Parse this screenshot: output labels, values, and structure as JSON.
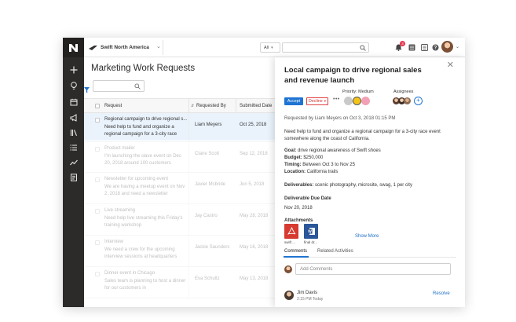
{
  "topbar": {
    "org_name": "Swift North America",
    "scope": "All",
    "notification_count": "3"
  },
  "list": {
    "title": "Marketing Work Requests",
    "search_placeholder": "",
    "columns": [
      "Request",
      "Requested By",
      "Submitted Date"
    ],
    "rows": [
      {
        "title": "Regional campaign to drive regional s...",
        "desc": "Need help to fund and organize a regional campaign for a 3-city race",
        "requester": "Liam Meyers",
        "date": "Oct 25, 2018"
      },
      {
        "title": "Product mailer",
        "desc": "I'm launching the slave event on Dec 20, 2018 around 100 customers",
        "requester": "Claire Scott",
        "date": "Sep 12, 2018"
      },
      {
        "title": "Newsletter for upcoming event",
        "desc": "We are having a meetup event on Nov 2, 2018 and need a newsletter",
        "requester": "Javier Mcbride",
        "date": "Jun 5, 2018"
      },
      {
        "title": "Live streaming",
        "desc": "Need help live streaming this Friday's training workshop",
        "requester": "Jay Castro",
        "date": "May 28, 2018"
      },
      {
        "title": "Interview",
        "desc": "We need a crew for the upcoming interview sessions at headquarters",
        "requester": "Jackie Saunders",
        "date": "May 16, 2018"
      },
      {
        "title": "Dinner event in Chicago",
        "desc": "Sales team is planning to host a dinner for our customers in",
        "requester": "Eva Schultz",
        "date": "May 13, 2018"
      }
    ]
  },
  "detail": {
    "title": "Local campaign to drive regional sales and revenue launch",
    "priority_label": "Priority: Medium",
    "assignees_label": "Assignees",
    "accept": "Accept",
    "decline": "Decline",
    "requested_line": "Requested by Liam Meyers on Oct 3, 2018 01:15 PM",
    "description": "Need help to fund and organize a regional campaign for a 3-city race event somewhere along the coast of California.",
    "goal_label": "Goal:",
    "goal": "drive regional awareness of Swift shoes",
    "budget_label": "Budget:",
    "budget": "$250,000",
    "timing_label": "Timing:",
    "timing": "Between Oct 3 to Nov 25",
    "location_label": "Location:",
    "location": "California trails",
    "deliverables_label": "Deliverables:",
    "deliverables": "scenic photography, microsite, swag, 1 per city",
    "due_label": "Deliverable Due Date",
    "due_date": "Nov 20, 2018",
    "attachments_label": "Attachments",
    "attachments": [
      {
        "name": "swift ...",
        "type": "pdf-icon"
      },
      {
        "name": "final dr...",
        "type": "word-doc-icon"
      }
    ],
    "show_more": "Show More",
    "tabs": [
      "Comments",
      "Related Activities"
    ],
    "comment_placeholder": "Add Comments",
    "comment_author": "Jim Davis",
    "comment_time": "2:15 PM Today",
    "resolve": "Resolve"
  },
  "colors": {
    "sidebar": "#2d2b2a",
    "accent": "#1f73d2",
    "decline": "#d03030",
    "selected_row": "#eaf3fc"
  }
}
